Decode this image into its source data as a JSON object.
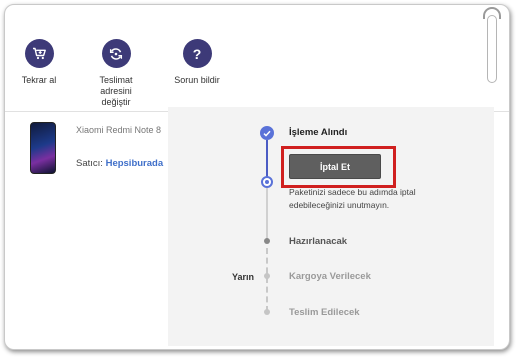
{
  "actions": {
    "reorder": {
      "label": "Tekrar al",
      "icon": "cart-plus-icon"
    },
    "change_address": {
      "label_line1": "Teslimat adresini",
      "label_line2": "değiştir",
      "icon": "refresh-icon"
    },
    "report_issue": {
      "label": "Sorun bildir",
      "icon": "question-icon"
    }
  },
  "product": {
    "name": "Xiaomi Redmi Note 8",
    "seller_label": "Satıcı:",
    "seller_name": "Hepsiburada"
  },
  "tracking": {
    "steps": [
      {
        "label": "İşleme Alındı",
        "state": "done"
      },
      {
        "label": "Hazırlanacak",
        "state": "pending"
      },
      {
        "label": "Kargoya Verilecek",
        "state": "future"
      },
      {
        "label": "Teslim Edilecek",
        "state": "future"
      }
    ],
    "day_label": "Yarın",
    "cancel_button": "İptal Et",
    "cancel_note": "Paketinizi sadece bu adımda iptal edebileceğinizi unutmayın."
  },
  "colors": {
    "accent": "#3d3a78",
    "timeline": "#5a72d8",
    "link": "#3f6fc9",
    "highlight": "#d0201f"
  }
}
